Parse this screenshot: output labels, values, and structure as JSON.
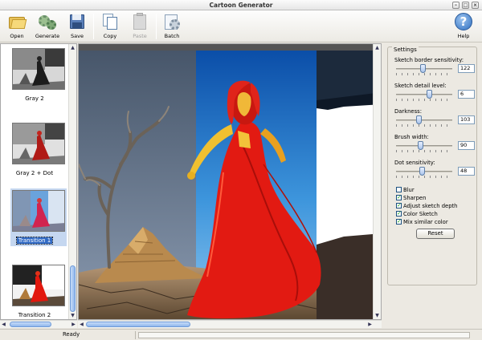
{
  "window": {
    "title": "Cartoon Generator"
  },
  "toolbar": {
    "open": "Open",
    "generate": "Generate",
    "save": "Save",
    "copy": "Copy",
    "paste": "Paste",
    "batch": "Batch",
    "help": "Help"
  },
  "presets": [
    {
      "label": "Gray 2",
      "selected": false
    },
    {
      "label": "Gray 2 + Dot",
      "selected": false
    },
    {
      "label": "Transition 1",
      "selected": true
    },
    {
      "label": "Transition 2",
      "selected": false
    }
  ],
  "settings": {
    "title": "Settings",
    "sliders": [
      {
        "label": "Sketch border sensitivity:",
        "value": "122",
        "fraction": 0.48
      },
      {
        "label": "Sketch detail level:",
        "value": "6",
        "fraction": 0.6
      },
      {
        "label": "Darkness:",
        "value": "103",
        "fraction": 0.4
      },
      {
        "label": "Brush width:",
        "value": "90",
        "fraction": 0.43
      },
      {
        "label": "Dot sensitivity:",
        "value": "48",
        "fraction": 0.46
      }
    ],
    "checkboxes": [
      {
        "label": "Blur",
        "checked": false
      },
      {
        "label": "Sharpen",
        "checked": true
      },
      {
        "label": "Adjust sketch depth",
        "checked": true
      },
      {
        "label": "Color Sketch",
        "checked": true
      },
      {
        "label": "Mix similar color",
        "checked": true
      }
    ],
    "reset": "Reset"
  },
  "status": {
    "text": "Ready"
  },
  "colors": {
    "accent": "#316ac5",
    "sky": "#3a8fd8",
    "dress": "#e21a12",
    "sand": "#b88a52"
  }
}
